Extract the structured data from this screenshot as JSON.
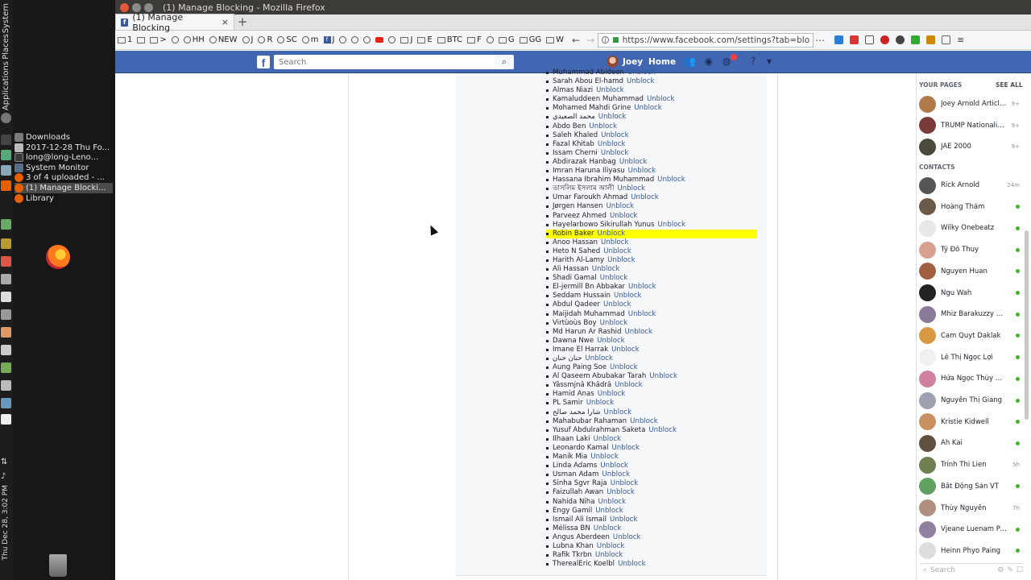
{
  "os_panel": {
    "labels": [
      "System",
      "Places",
      "Applications"
    ],
    "clock": "Thu Dec 28, 3:02 PM"
  },
  "taskbar": {
    "windows": [
      {
        "label": "Downloads",
        "color": "#7a7a7a"
      },
      {
        "label": "2017-12-28 Thu Fo...",
        "color": "#bbbbbb"
      },
      {
        "label": "long@long-Leno...",
        "color": "#3a3a3a"
      },
      {
        "label": "System Monitor",
        "color": "#5a6e8a"
      },
      {
        "label": "3 of 4 uploaded - ...",
        "color": "#e66000"
      },
      {
        "label": "(1) Manage Blocki...",
        "color": "#e66000"
      },
      {
        "label": "Library",
        "color": "#e66000"
      }
    ]
  },
  "window": {
    "title": "(1) Manage Blocking - Mozilla Firefox"
  },
  "tabs": [
    {
      "label": "(1) Manage Blocking",
      "close": "×"
    }
  ],
  "newtab": "+",
  "bookmarks": [
    "1",
    ">",
    "HH",
    "NEW",
    "J",
    "R",
    "SC",
    "m",
    "J",
    "J",
    "E",
    "BTC",
    "F",
    "G",
    "GG",
    "W"
  ],
  "url": "https://www.facebook.com/settings?tab=blo",
  "facebook": {
    "logo": "f",
    "search_placeholder": "Search",
    "user": "Joey",
    "home": "Home"
  },
  "blocked": [
    "Muhammad Abideen",
    "Sarah Abou El-hamd",
    "Almas Niazi",
    "Kamaluddeen Muhammad",
    "Mohamed Mahdi Grine",
    "محمد الصعيدي",
    "Abdo Ben",
    "Saleh Khaled",
    "Fazal Khitab",
    "Issam Cherni",
    "Abdirazak Hanbag",
    "Imran Haruna Iliyasu",
    "Hassana Ibrahim Muhammad",
    "তাসলিম ইসলাম আলী",
    "Umar Faroukh Ahmad",
    "Jørgen Hansen",
    "Parveez Ahmed",
    "Hayelarbowo Sikirullah Yunus",
    "Robin Baker",
    "Anoo Hassan",
    "Heto N Sahed",
    "Harith Al-Lamy",
    "Ali Hassan",
    "Shadi Gamal",
    "El-jermill Bn Abbakar",
    "Seddam Hussain",
    "Abdul Qadeer",
    "Maijidah Muhammad",
    "Virtùoùs Boy",
    "Md Harun Ar Rashid",
    "Dawna Nwe",
    "Imane El Harrak",
    "حنان حنان",
    "Aung Paing Soe",
    "Al Qaseem Abubakar Tarah",
    "Yâssmjnâ Khâdrâ",
    "Hamid Anas",
    "PL Samir",
    "شارا محمد صالح",
    "Mahabubar Rahaman",
    "Yusuf Abdulrahman Saketa",
    "Ilhaan Laki",
    "Leonardo Kamal",
    "Manik Mia",
    "Linda Adams",
    "Usman Adam",
    "Sinha Sgvr Raja",
    "Faizullah Awan",
    "Nahida Niha",
    "Engy Gamil",
    "Ismail Ali Ismail",
    "Mélissa BN",
    "Angus Aberdeen",
    "Lubna Khan",
    "Rafik Tkrbn",
    "TherealEric Koelbl"
  ],
  "unblock_label": "Unblock",
  "highlighted": "Robin Baker",
  "chat": {
    "pages_heading": "YOUR PAGES",
    "see_all": "SEE ALL",
    "contacts_heading": "CONTACTS",
    "search_placeholder": "Search",
    "pages": [
      {
        "name": "Joey Arnold Articles",
        "meta": "9+",
        "color": "#b07a4a"
      },
      {
        "name": "TRUMP Nationalism ...",
        "meta": "9+",
        "color": "#7a3b3b"
      },
      {
        "name": "JAE 2000",
        "meta": "9+",
        "color": "#4a4a3a"
      }
    ],
    "contacts": [
      {
        "name": "Rick Arnold",
        "meta": "24m",
        "color": "#555555"
      },
      {
        "name": "Hoàng Thám",
        "meta": "",
        "color": "#6b5a4a"
      },
      {
        "name": "Wilky Onebeatz",
        "meta": "",
        "color": "#e8e8e8"
      },
      {
        "name": "Tý Đô Thuy",
        "meta": "",
        "color": "#d8a090"
      },
      {
        "name": "Nguyen Huan",
        "meta": "",
        "color": "#a06040"
      },
      {
        "name": "Ngu Wah",
        "meta": "",
        "color": "#222222"
      },
      {
        "name": "Mhiz Barakuzzy Emill...",
        "meta": "",
        "color": "#8a7a9a"
      },
      {
        "name": "Cam Quyt Daklak",
        "meta": "",
        "color": "#d89a40"
      },
      {
        "name": "Lê Thị Ngọc Lợi",
        "meta": "",
        "color": "#f0f0f0"
      },
      {
        "name": "Hứa Ngọc Thùy Dung",
        "meta": "",
        "color": "#d080a0"
      },
      {
        "name": "Nguyễn Thị Giang",
        "meta": "",
        "color": "#a0a0b0"
      },
      {
        "name": "Kristie Kidwell",
        "meta": "",
        "color": "#c89060"
      },
      {
        "name": "Ah Kai",
        "meta": "",
        "color": "#605040"
      },
      {
        "name": "Trinh Thi Lien",
        "meta": "5h",
        "color": "#708050"
      },
      {
        "name": "Bất Động Sản VT",
        "meta": "",
        "color": "#60a060"
      },
      {
        "name": "Thùy Nguyễn",
        "meta": "7h",
        "color": "#b09080"
      },
      {
        "name": "Vjeane Luenam Patr...",
        "meta": "",
        "color": "#9080a0"
      },
      {
        "name": "Heinn Phyo Paing",
        "meta": "",
        "color": "#dddddd"
      }
    ]
  }
}
